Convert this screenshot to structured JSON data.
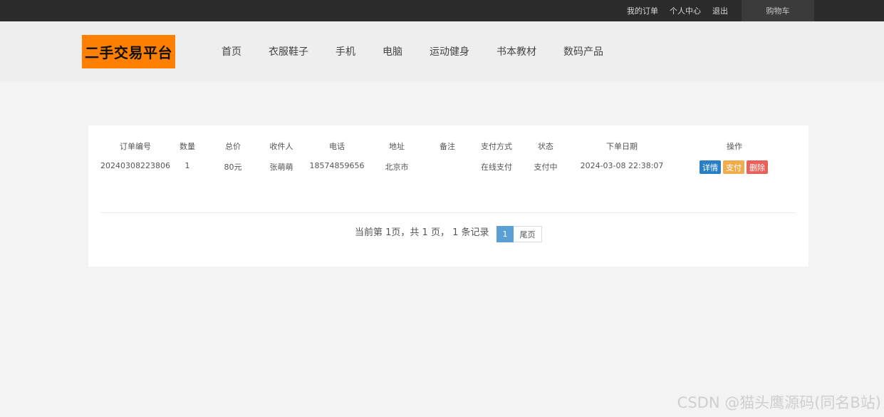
{
  "topbar": {
    "my_orders": "我的订单",
    "user_center": "个人中心",
    "logout": "退出",
    "cart": "购物车"
  },
  "header": {
    "logo": "二手交易平台",
    "nav": [
      "首页",
      "衣服鞋子",
      "手机",
      "电脑",
      "运动健身",
      "书本教材",
      "数码产品"
    ]
  },
  "orders": {
    "columns": [
      "订单编号",
      "数量",
      "总价",
      "收件人",
      "电话",
      "地址",
      "备注",
      "支付方式",
      "状态",
      "下单日期",
      "操作"
    ],
    "rows": [
      {
        "order_no": "20240308223806",
        "quantity": "1",
        "total": "80元",
        "receiver": "张萌萌",
        "phone": "18574859656",
        "address": "北京市",
        "remark": "",
        "payment": "在线支付",
        "status": "支付中",
        "date": "2024-03-08 22:38:07",
        "actions": [
          "详情",
          "支付",
          "删除"
        ]
      }
    ]
  },
  "pagination": {
    "summary": "当前第 1页，共 1 页， 1 条记录",
    "current_page": "1",
    "last_label": "尾页"
  },
  "watermark": "CSDN @猫头鹰源码(同名B站)",
  "colors": {
    "topbar": "#2b2b2b",
    "logo_bg": "#ff7f00",
    "detail_btn": "#2a7fc4",
    "pay_btn": "#f0ad4e",
    "delete_btn": "#e9605b",
    "page_active": "#5aa0d4"
  }
}
